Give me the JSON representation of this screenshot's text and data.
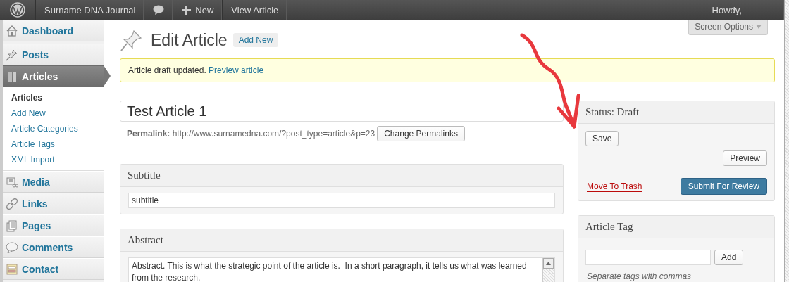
{
  "admin_bar": {
    "site_name": "Surname DNA Journal",
    "new_label": "New",
    "view_label": "View Article",
    "greeting": "Howdy,"
  },
  "sidebar": {
    "items": [
      {
        "label": "Dashboard",
        "kind": "home",
        "selected": false
      },
      {
        "label": "Posts",
        "kind": "pin",
        "selected": false
      },
      {
        "label": "Articles",
        "kind": "doc",
        "selected": true,
        "children": [
          {
            "label": "Articles",
            "selected": true
          },
          {
            "label": "Add New",
            "selected": false
          },
          {
            "label": "Article Categories",
            "selected": false
          },
          {
            "label": "Article Tags",
            "selected": false
          },
          {
            "label": "XML Import",
            "selected": false
          }
        ]
      },
      {
        "label": "Media",
        "kind": "media",
        "selected": false
      },
      {
        "label": "Links",
        "kind": "link",
        "selected": false
      },
      {
        "label": "Pages",
        "kind": "pages",
        "selected": false
      },
      {
        "label": "Comments",
        "kind": "comment",
        "selected": false
      },
      {
        "label": "Contact",
        "kind": "form",
        "selected": false
      }
    ]
  },
  "header": {
    "title": "Edit Article",
    "add_new": "Add New",
    "screen_options": "Screen Options"
  },
  "notice": {
    "text": "Article draft updated.",
    "link": "Preview article"
  },
  "title_field": {
    "value": "Test Article 1"
  },
  "permalink": {
    "label": "Permalink:",
    "url": "http://www.surnamedna.com/?post_type=article&p=23",
    "button": "Change Permalinks"
  },
  "boxes": [
    {
      "title": "Subtitle",
      "kind": "input",
      "value": "subtitle"
    },
    {
      "title": "Abstract",
      "kind": "textarea",
      "value": "Abstract. This is what the strategic point of the article is.  In a short paragraph, it tells us what was learned from the research."
    }
  ],
  "publish": {
    "title": "Status: Draft",
    "save": "Save",
    "preview": "Preview",
    "trash": "Move To Trash",
    "submit": "Submit For Review"
  },
  "tag_box": {
    "title": "Article Tag",
    "add": "Add",
    "hint": "Separate tags with commas"
  }
}
